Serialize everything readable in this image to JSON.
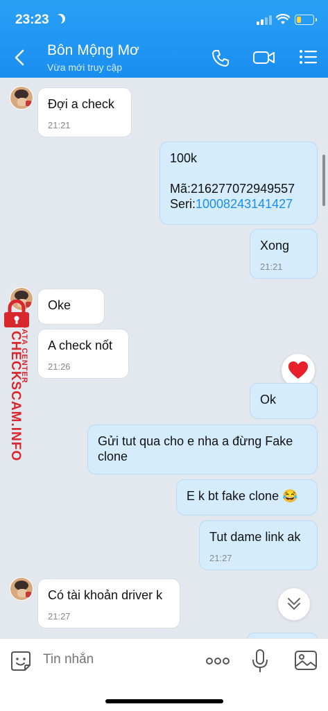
{
  "status_bar": {
    "time": "23:23"
  },
  "header": {
    "contact_name": "Bôn Mộng Mơ",
    "contact_status": "Vừa mới truy cập"
  },
  "messages": [
    {
      "side": "in",
      "text": "Đợi a check",
      "time": "21:21"
    },
    {
      "side": "out",
      "lines": [
        "100k",
        "",
        "Mã:216277072949557"
      ],
      "seri_label": "Seri:",
      "seri_value": "10008243141427"
    },
    {
      "side": "out",
      "text": "Xong",
      "time": "21:21"
    },
    {
      "side": "in",
      "text": "Oke"
    },
    {
      "side": "in",
      "text": "A check nốt",
      "time": "21:26"
    },
    {
      "side": "out",
      "text": "Ok"
    },
    {
      "side": "out",
      "lines": [
        "Gửi tut qua cho e nha a đừng Fake",
        "clone"
      ]
    },
    {
      "side": "out",
      "text": "E k bt fake clone 😂"
    },
    {
      "side": "out",
      "text": "Tut dame link ak",
      "time": "21:27"
    },
    {
      "side": "in",
      "text": "Có tài khoản driver k",
      "time": "21:27"
    }
  ],
  "watermark": {
    "main": "CHECKSCAM.INFO",
    "sub": "DATA CENTER"
  },
  "input": {
    "placeholder": "Tin nhắn"
  },
  "icons": [
    "back-icon",
    "phone-icon",
    "video-icon",
    "menu-icon",
    "sticker-icon",
    "more-icon",
    "mic-icon",
    "image-icon",
    "heart-icon",
    "chevron-double-down-icon"
  ],
  "colors": {
    "header": "#1a8ef0",
    "outgoing": "#d4ecfc",
    "incoming": "#ffffff",
    "link": "#1a8ef0",
    "watermark": "#d9272e"
  }
}
